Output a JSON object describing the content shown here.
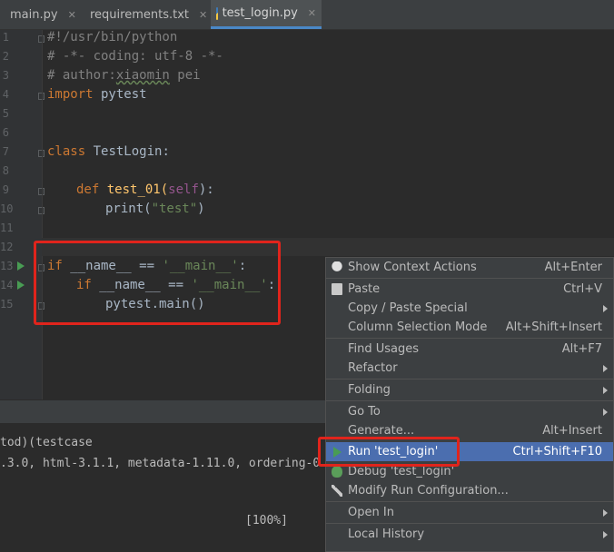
{
  "tabs": [
    {
      "label": "main.py",
      "icon": "python-file-icon"
    },
    {
      "label": "requirements.txt",
      "icon": "text-file-icon"
    },
    {
      "label": "test_login.py",
      "icon": "python-file-icon"
    }
  ],
  "line_numbers": [
    "1",
    "2",
    "3",
    "4",
    "5",
    "6",
    "7",
    "8",
    "9",
    "10",
    "11",
    "12",
    "13",
    "14",
    "15"
  ],
  "code": {
    "l1": "#!/usr/bin/python",
    "l2": "# -*- coding: utf-8 -*-",
    "l3a": "# author:",
    "l3b": "xiaomin",
    "l3c": " pei",
    "l4a": "import",
    "l4b": " pytest",
    "l7a": "class",
    "l7b": " TestLogin:",
    "l9a": "def",
    "l9b": " test_01(",
    "l9c": "self",
    "l9d": "):",
    "l10a": "print(",
    "l10b": "\"test\"",
    "l10c": ")",
    "l13a": "if",
    "l13b": " __name__ == ",
    "l13c": "'__main__'",
    "l13d": ":",
    "l14a": "if",
    "l14b": " __name__ == ",
    "l14c": "'__main__'",
    "l14d": ":",
    "l15": "pytest.main()"
  },
  "console": {
    "line1": "tod)(testcase",
    "line2": ".3.0, html-3.1.1, metadata-1.11.0, ordering-0",
    "progress": "[100%]"
  },
  "context_menu": {
    "items": [
      {
        "label": "Show Context Actions",
        "shortcut": "Alt+Enter",
        "icon": "lightbulb-icon"
      },
      {
        "label": "Paste",
        "shortcut": "Ctrl+V",
        "icon": "clipboard-icon"
      },
      {
        "label": "Copy / Paste Special",
        "shortcut": ""
      },
      {
        "label": "Column Selection Mode",
        "shortcut": "Alt+Shift+Insert"
      },
      {
        "label": "Find Usages",
        "shortcut": "Alt+F7"
      },
      {
        "label": "Refactor",
        "shortcut": ""
      },
      {
        "label": "Folding",
        "shortcut": ""
      },
      {
        "label": "Go To",
        "shortcut": ""
      },
      {
        "label": "Generate...",
        "shortcut": "Alt+Insert"
      },
      {
        "label": "Run 'test_login'",
        "shortcut": "Ctrl+Shift+F10",
        "icon": "run-icon"
      },
      {
        "label": "Debug 'test_login'",
        "shortcut": "",
        "icon": "debug-icon"
      },
      {
        "label": "Modify Run Configuration...",
        "shortcut": "",
        "icon": "wrench-icon"
      },
      {
        "label": "Open In",
        "shortcut": ""
      },
      {
        "label": "Local History",
        "shortcut": ""
      }
    ]
  },
  "colors": {
    "keyword": "#cc7832",
    "string": "#6a8759",
    "selection": "#4b6eaf",
    "highlight_box": "#e0241c"
  }
}
